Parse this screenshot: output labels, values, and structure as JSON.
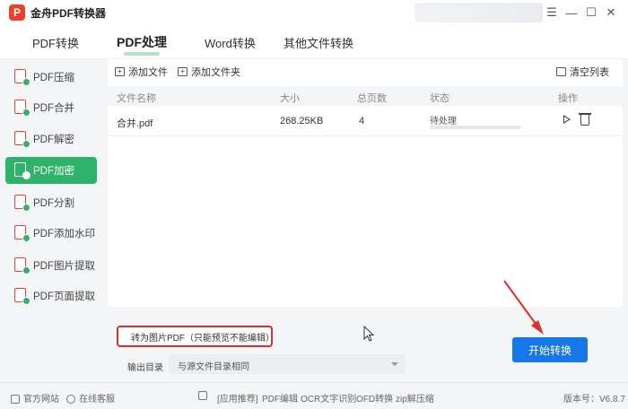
{
  "app": {
    "title": "金舟PDF转换器",
    "logo_letter": "P"
  },
  "window_controls": {
    "menu": "☰",
    "minimize": "—",
    "maximize": "☐",
    "close": "✕"
  },
  "top_tabs": [
    "PDF转换",
    "PDF处理",
    "Word转换",
    "其他文件转换"
  ],
  "active_top_tab": "PDF处理",
  "sidebar": {
    "items": [
      "PDF压缩",
      "PDF合并",
      "PDF解密",
      "PDF加密",
      "PDF分割",
      "PDF添加水印",
      "PDF图片提取",
      "PDF页面提取"
    ],
    "active": "PDF加密"
  },
  "toolbar": {
    "add_file": "添加文件",
    "add_folder": "添加文件夹",
    "clear_list": "清空列表"
  },
  "table": {
    "headers": [
      "文件名称",
      "大小",
      "总页数",
      "状态",
      "操作"
    ],
    "rows": [
      {
        "name": "合并.pdf",
        "size": "268.25KB",
        "pages": "4",
        "status": "待处理",
        "progress": 0
      }
    ]
  },
  "options": {
    "convert_to_image_pdf": "转为图片PDF（只能预览不能编辑）",
    "convert_to_image_pdf_checked": true,
    "output_dir_label": "输出目录",
    "output_dir_value": "与源文件目录相同"
  },
  "start_button": "开始转换",
  "statusbar": {
    "website": "官方网站",
    "support": "在线客服",
    "links": [
      "[应用推荐]",
      "PDF编辑",
      "OCR文字识别",
      "OFD转换",
      "zip解压缩"
    ],
    "version": "版本号：V6.8.7"
  },
  "colors": {
    "accent_green": "#2fb36b",
    "primary_blue": "#1677e8",
    "highlight_red": "#d9302a",
    "brand_red": "#e8412c"
  }
}
